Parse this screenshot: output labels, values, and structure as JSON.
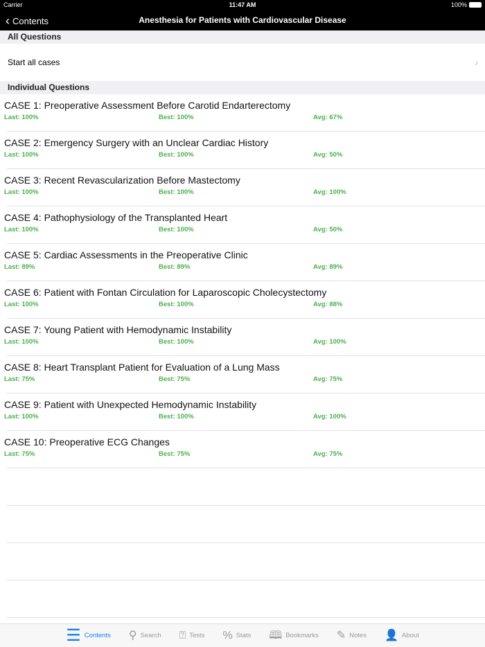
{
  "status": {
    "carrier": "Carrier",
    "time": "11:47 AM",
    "battery": "100%"
  },
  "nav": {
    "back": "Contents",
    "title": "Anesthesia for Patients with Cardiovascular Disease"
  },
  "sections": {
    "all": "All Questions",
    "individual": "Individual Questions"
  },
  "start_all": "Start all cases",
  "cases": [
    {
      "title": "CASE 1: Preoperative Assessment Before Carotid Endarterectomy",
      "last": "Last: 100%",
      "best": "Best: 100%",
      "avg": "Avg: 67%"
    },
    {
      "title": "CASE 2: Emergency Surgery with an Unclear Cardiac History",
      "last": "Last: 100%",
      "best": "Best: 100%",
      "avg": "Avg: 50%"
    },
    {
      "title": "CASE 3: Recent Revascularization Before Mastectomy",
      "last": "Last: 100%",
      "best": "Best: 100%",
      "avg": "Avg: 100%"
    },
    {
      "title": "CASE 4: Pathophysiology of the Transplanted Heart",
      "last": "Last: 100%",
      "best": "Best: 100%",
      "avg": "Avg: 50%"
    },
    {
      "title": "CASE 5: Cardiac Assessments in the Preoperative Clinic",
      "last": "Last: 89%",
      "best": "Best: 89%",
      "avg": "Avg: 89%"
    },
    {
      "title": "CASE 6: Patient with Fontan Circulation for Laparoscopic Cholecystectomy",
      "last": "Last: 100%",
      "best": "Best: 100%",
      "avg": "Avg: 88%"
    },
    {
      "title": "CASE 7: Young Patient with Hemodynamic Instability",
      "last": "Last: 100%",
      "best": "Best: 100%",
      "avg": "Avg: 100%"
    },
    {
      "title": "CASE 8: Heart Transplant Patient for Evaluation of a Lung Mass",
      "last": "Last: 75%",
      "best": "Best: 75%",
      "avg": "Avg: 75%"
    },
    {
      "title": "CASE 9: Patient with Unexpected Hemodynamic Instability",
      "last": "Last: 100%",
      "best": "Best: 100%",
      "avg": "Avg: 100%"
    },
    {
      "title": "CASE 10: Preoperative ECG Changes",
      "last": "Last: 75%",
      "best": "Best: 75%",
      "avg": "Avg: 75%"
    }
  ],
  "tabs": [
    {
      "label": "Contents",
      "icon": "☰",
      "name": "contents"
    },
    {
      "label": "Search",
      "icon": "⚲",
      "name": "search"
    },
    {
      "label": "Tests",
      "icon": "⍰",
      "name": "tests"
    },
    {
      "label": "Stats",
      "icon": "%",
      "name": "stats"
    },
    {
      "label": "Bookmarks",
      "icon": "🕮",
      "name": "bookmarks"
    },
    {
      "label": "Notes",
      "icon": "✎",
      "name": "notes"
    },
    {
      "label": "About",
      "icon": "👤",
      "name": "about"
    }
  ],
  "colors": {
    "accent": "#1a7cf5",
    "score": "#4cb04f"
  }
}
